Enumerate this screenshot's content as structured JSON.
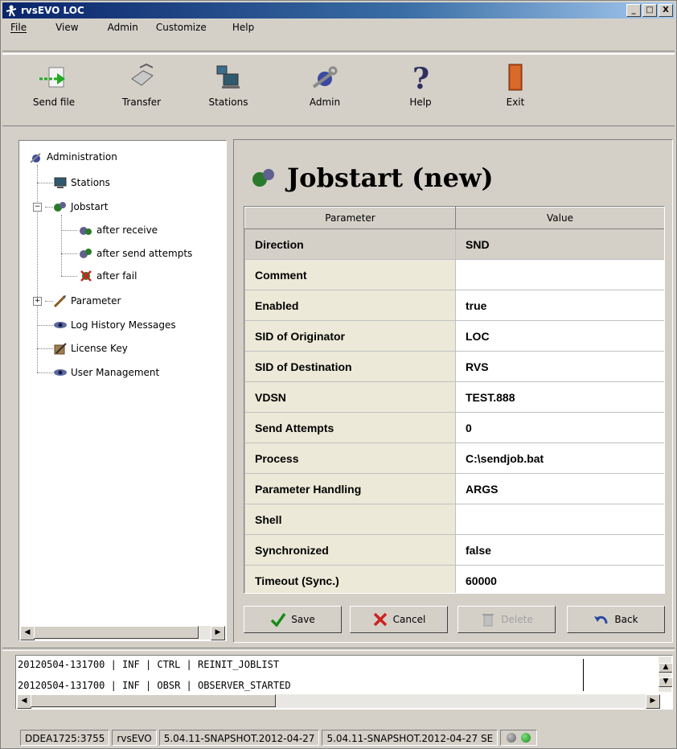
{
  "window": {
    "title": "rvsEVO LOC",
    "controls": [
      "_",
      "□",
      "X"
    ]
  },
  "menu": [
    {
      "label": "File"
    },
    {
      "label": "View"
    },
    {
      "label": "Admin"
    },
    {
      "label": "Customize"
    },
    {
      "label": "Help"
    }
  ],
  "toolbar": {
    "send_file": "Send file",
    "transfer": "Transfer",
    "stations": "Stations",
    "admin": "Admin",
    "help": "Help",
    "exit": "Exit"
  },
  "tree": {
    "root": "Administration",
    "stations": "Stations",
    "jobstart": "Jobstart",
    "after_receive": "after receive",
    "after_send_attempts": "after send attempts",
    "after_fail": "after fail",
    "parameter": "Parameter",
    "log_history": "Log History Messages",
    "license_key": "License Key",
    "user_management": "User Management",
    "expander_minus": "−",
    "expander_plus": "+"
  },
  "panel": {
    "title": "Jobstart (new)",
    "columns": {
      "parameter": "Parameter",
      "value": "Value"
    },
    "rows": [
      {
        "param": "Direction",
        "value": "SND"
      },
      {
        "param": "Comment",
        "value": ""
      },
      {
        "param": "Enabled",
        "value": "true"
      },
      {
        "param": "SID of Originator",
        "value": "LOC"
      },
      {
        "param": "SID of Destination",
        "value": "RVS"
      },
      {
        "param": "VDSN",
        "value": "TEST.888"
      },
      {
        "param": "Send Attempts",
        "value": "0"
      },
      {
        "param": "Process",
        "value": "C:\\sendjob.bat"
      },
      {
        "param": "Parameter Handling",
        "value": "ARGS"
      },
      {
        "param": "Shell",
        "value": ""
      },
      {
        "param": "Synchronized",
        "value": "false"
      },
      {
        "param": "Timeout (Sync.)",
        "value": "60000"
      }
    ],
    "buttons": {
      "save": "Save",
      "cancel": "Cancel",
      "delete": "Delete",
      "back": "Back"
    }
  },
  "log": {
    "lines": [
      "20120504-131700 | INF | CTRL | REINIT_JOBLIST",
      "20120504-131700 | INF | OBSR | OBSERVER_STARTED"
    ]
  },
  "status": {
    "host": "DDEA1725:3755",
    "app": "rvsEVO",
    "version1": "5.04.11-SNAPSHOT.2012-04-27",
    "version2": "5.04.11-SNAPSHOT.2012-04-27 SE"
  },
  "colors": {
    "led_gray": "#808080",
    "led_green": "#22aa22",
    "title_blue": "#0a246a"
  }
}
